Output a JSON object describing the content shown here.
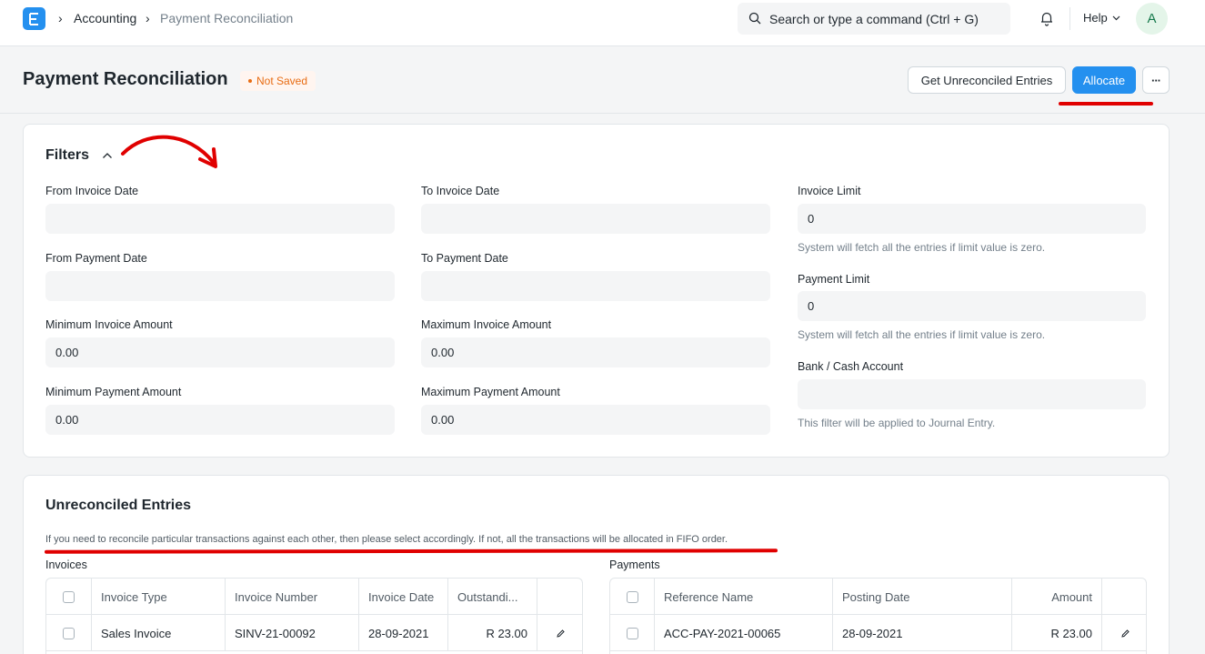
{
  "navbar": {
    "logo_letter": "E",
    "breadcrumbs": [
      "Accounting",
      "Payment Reconciliation"
    ],
    "search_placeholder": "Search or type a command (Ctrl + G)",
    "help_label": "Help",
    "avatar_initial": "A"
  },
  "page": {
    "title": "Payment Reconciliation",
    "status": "Not Saved",
    "get_entries_label": "Get Unreconciled Entries",
    "allocate_label": "Allocate",
    "more_label": "···"
  },
  "filters": {
    "title": "Filters",
    "from_invoice_date": {
      "label": "From Invoice Date",
      "value": ""
    },
    "to_invoice_date": {
      "label": "To Invoice Date",
      "value": ""
    },
    "invoice_limit": {
      "label": "Invoice Limit",
      "value": "0",
      "help": "System will fetch all the entries if limit value is zero."
    },
    "from_payment_date": {
      "label": "From Payment Date",
      "value": ""
    },
    "to_payment_date": {
      "label": "To Payment Date",
      "value": ""
    },
    "payment_limit": {
      "label": "Payment Limit",
      "value": "0",
      "help": "System will fetch all the entries if limit value is zero."
    },
    "min_invoice_amount": {
      "label": "Minimum Invoice Amount",
      "value": "0.00"
    },
    "max_invoice_amount": {
      "label": "Maximum Invoice Amount",
      "value": "0.00"
    },
    "bank_cash_account": {
      "label": "Bank / Cash Account",
      "value": "",
      "help": "This filter will be applied to Journal Entry."
    },
    "min_payment_amount": {
      "label": "Minimum Payment Amount",
      "value": "0.00"
    },
    "max_payment_amount": {
      "label": "Maximum Payment Amount",
      "value": "0.00"
    }
  },
  "unreconciled": {
    "title": "Unreconciled Entries",
    "description": "If you need to reconcile particular transactions against each other, then please select accordingly. If not, all the transactions will be allocated in FIFO order.",
    "invoices": {
      "label": "Invoices",
      "columns": [
        "Invoice Type",
        "Invoice Number",
        "Invoice Date",
        "Outstandi..."
      ],
      "rows": [
        {
          "type": "Sales Invoice",
          "number": "SINV-21-00092",
          "date": "28-09-2021",
          "outstanding": "R 23.00"
        }
      ]
    },
    "payments": {
      "label": "Payments",
      "columns": [
        "Reference Name",
        "Posting Date",
        "Amount"
      ],
      "rows": [
        {
          "reference": "ACC-PAY-2021-00065",
          "date": "28-09-2021",
          "amount": "R 23.00"
        }
      ]
    }
  },
  "colors": {
    "primary": "#2490ef",
    "annotation": "#e00000",
    "status": "#e86c13"
  }
}
